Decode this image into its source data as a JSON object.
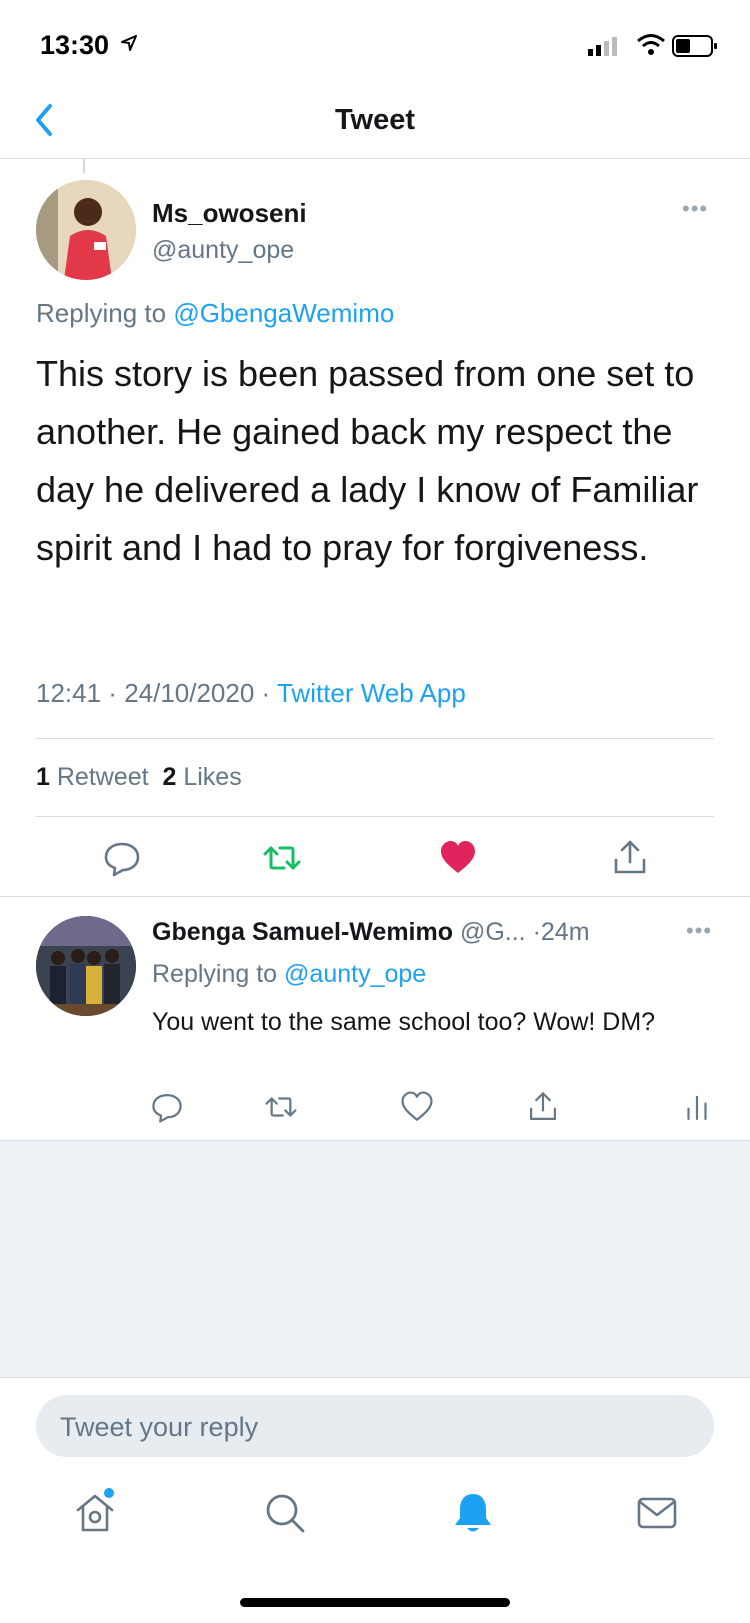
{
  "status_bar": {
    "time": "13:30"
  },
  "nav": {
    "title": "Tweet",
    "back_icon": "chevron-left-icon"
  },
  "main_tweet": {
    "name": "Ms_owoseni",
    "handle": "@aunty_ope",
    "replying_prefix": "Replying to ",
    "replying_to": "@GbengaWemimo",
    "text": "This story is been passed from one set to another.  He gained back my respect the day he delivered a lady I know of Familiar spirit and I had to pray for forgiveness.",
    "time": "12:41",
    "date": "24/10/2020",
    "source": "Twitter Web App",
    "retweets_count": "1",
    "retweets_label": "Retweet",
    "likes_count": "2",
    "likes_label": "Likes",
    "liked": true
  },
  "reply_tweet": {
    "name": "Gbenga Samuel-Wemimo",
    "handle": "@G...",
    "age": "24m",
    "replying_prefix": "Replying to ",
    "replying_to": "@aunty_ope",
    "text": "You went to the same school too? Wow! DM?"
  },
  "composer": {
    "placeholder": "Tweet your reply"
  },
  "tab_bar": {
    "items": [
      "home-icon",
      "search-icon",
      "notifications-icon",
      "messages-icon"
    ],
    "active": "notifications-icon"
  },
  "colors": {
    "accent": "#1da1f2",
    "like": "#e0245e",
    "retweet": "#17bf63",
    "secondary": "#657786"
  }
}
